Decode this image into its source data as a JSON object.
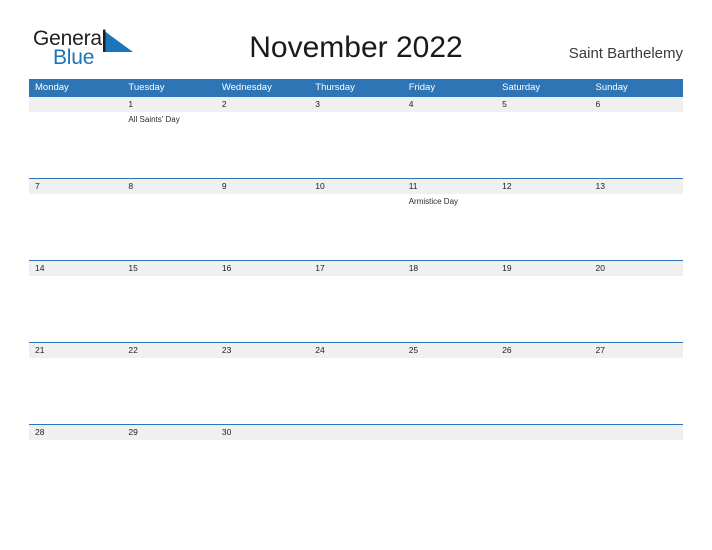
{
  "brand": {
    "word_one": "General",
    "word_two": "Blue",
    "flag_icon": "blue-triangle-flag-icon",
    "color_dark": "#231f20",
    "color_blue": "#1b75bb"
  },
  "header": {
    "month_title": "November 2022",
    "location": "Saint Barthelemy"
  },
  "theme": {
    "header_blue": "#2e75b6",
    "date_band_gray": "#f0f0f0",
    "row_border": "#2e75b6",
    "text_dark": "#222222"
  },
  "calendar": {
    "weekdays": [
      "Monday",
      "Tuesday",
      "Wednesday",
      "Thursday",
      "Friday",
      "Saturday",
      "Sunday"
    ],
    "weeks": [
      {
        "days": [
          {
            "date": "",
            "event": ""
          },
          {
            "date": "1",
            "event": "All Saints' Day"
          },
          {
            "date": "2",
            "event": ""
          },
          {
            "date": "3",
            "event": ""
          },
          {
            "date": "4",
            "event": ""
          },
          {
            "date": "5",
            "event": ""
          },
          {
            "date": "6",
            "event": ""
          }
        ]
      },
      {
        "days": [
          {
            "date": "7",
            "event": ""
          },
          {
            "date": "8",
            "event": ""
          },
          {
            "date": "9",
            "event": ""
          },
          {
            "date": "10",
            "event": ""
          },
          {
            "date": "11",
            "event": "Armistice Day"
          },
          {
            "date": "12",
            "event": ""
          },
          {
            "date": "13",
            "event": ""
          }
        ]
      },
      {
        "days": [
          {
            "date": "14",
            "event": ""
          },
          {
            "date": "15",
            "event": ""
          },
          {
            "date": "16",
            "event": ""
          },
          {
            "date": "17",
            "event": ""
          },
          {
            "date": "18",
            "event": ""
          },
          {
            "date": "19",
            "event": ""
          },
          {
            "date": "20",
            "event": ""
          }
        ]
      },
      {
        "days": [
          {
            "date": "21",
            "event": ""
          },
          {
            "date": "22",
            "event": ""
          },
          {
            "date": "23",
            "event": ""
          },
          {
            "date": "24",
            "event": ""
          },
          {
            "date": "25",
            "event": ""
          },
          {
            "date": "26",
            "event": ""
          },
          {
            "date": "27",
            "event": ""
          }
        ]
      },
      {
        "days": [
          {
            "date": "28",
            "event": ""
          },
          {
            "date": "29",
            "event": ""
          },
          {
            "date": "30",
            "event": ""
          },
          {
            "date": "",
            "event": ""
          },
          {
            "date": "",
            "event": ""
          },
          {
            "date": "",
            "event": ""
          },
          {
            "date": "",
            "event": ""
          }
        ]
      }
    ]
  }
}
